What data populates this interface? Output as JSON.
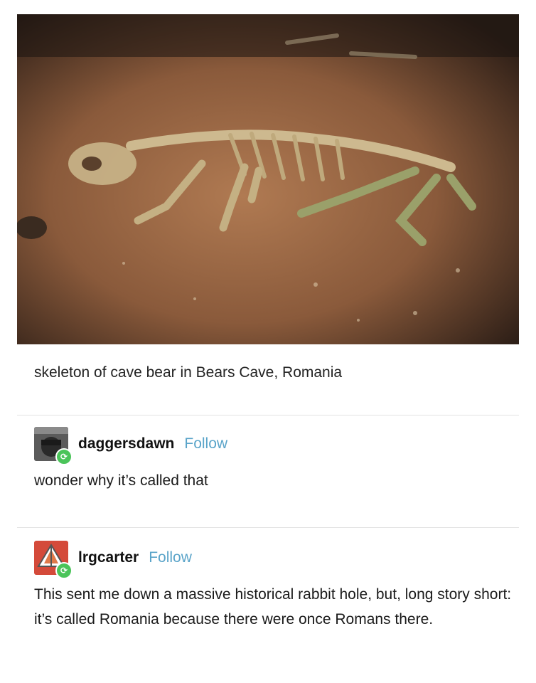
{
  "post": {
    "photo_alt": "cave bear skeleton photo",
    "caption": "skeleton of cave bear in Bears Cave, Romania"
  },
  "reblogs": [
    {
      "username": "daggersdawn",
      "follow_label": "Follow",
      "text": "wonder why it’s called that"
    },
    {
      "username": "lrgcarter",
      "follow_label": "Follow",
      "text": "This sent me down a massive historical rabbit hole, but, long story short: it’s called Romania because there were once Romans there."
    }
  ],
  "colors": {
    "follow_link": "#5aa4c9",
    "reblog_badge": "#4bc45a",
    "divider": "#e3e3e3"
  },
  "icons": [
    "reblog-icon",
    "reblog-icon"
  ]
}
